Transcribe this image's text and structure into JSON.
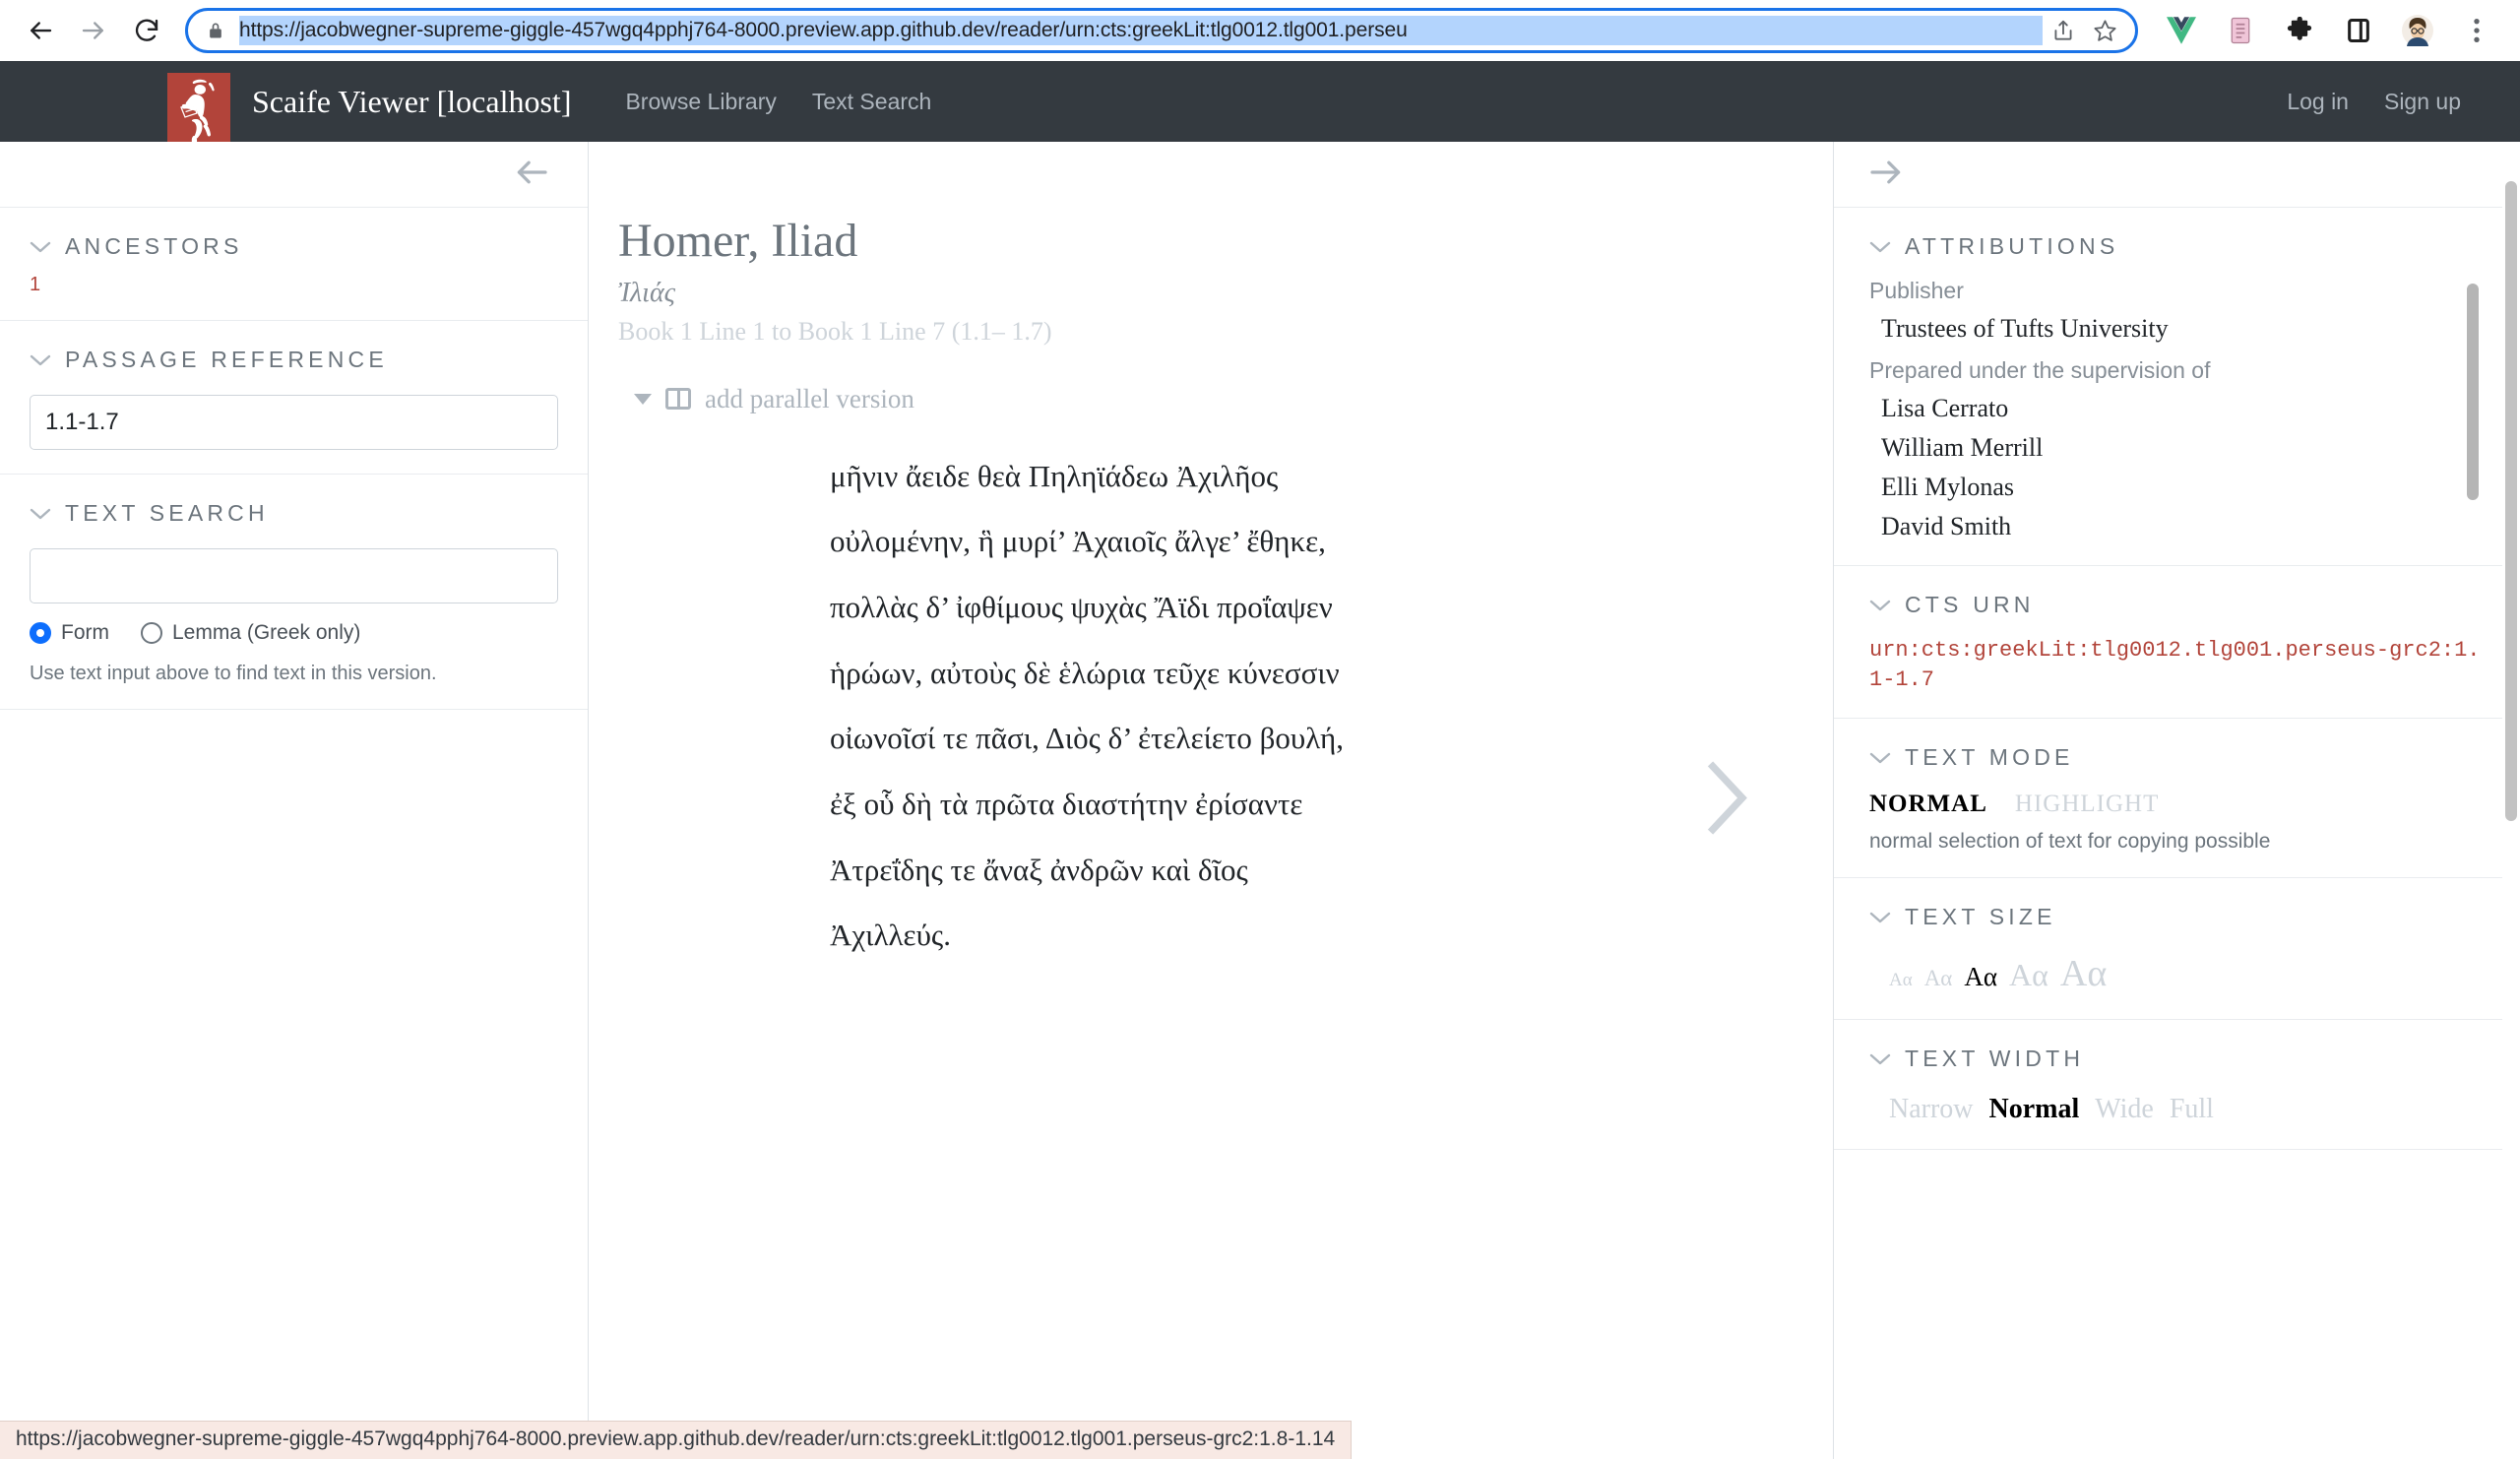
{
  "browser": {
    "back_icon": "arrow-left-icon",
    "forward_icon": "arrow-right-icon",
    "reload_icon": "reload-icon",
    "lock_icon": "lock-icon",
    "url": "https://jacobwegner-supreme-giggle-457wgq4pphj764-8000.preview.app.github.dev/reader/urn:cts:greekLit:tlg0012.tlg001.perseu",
    "share_icon": "share-icon",
    "bookmark_icon": "star-icon",
    "extensions": [
      "vue-devtools-icon",
      "reading-list-icon",
      "puzzle-piece-icon",
      "sidebar-panel-icon",
      "profile-avatar-icon",
      "kebab-menu-icon"
    ],
    "accent": "#1a73e8",
    "selection_color": "#b3d4fd"
  },
  "header": {
    "brand": "Scaife Viewer [localhost]",
    "logo_alt": "scaife-runner-logo",
    "logo_bg": "#b2443a",
    "bar_bg": "#343a40",
    "nav": [
      {
        "label": "Browse Library",
        "name": "nav-browse-library"
      },
      {
        "label": "Text Search",
        "name": "nav-text-search"
      }
    ],
    "nav_right": [
      {
        "label": "Log in",
        "name": "nav-login"
      },
      {
        "label": "Sign up",
        "name": "nav-signup"
      }
    ]
  },
  "left_sidebar": {
    "collapse_icon": "arrow-left-icon",
    "ancestors": {
      "title": "Ancestors",
      "items": [
        "1"
      ]
    },
    "passage_reference": {
      "title": "Passage Reference",
      "value": "1.1-1.7"
    },
    "text_search": {
      "title": "Text Search",
      "value": "",
      "placeholder": "",
      "options": [
        {
          "label": "Form",
          "checked": true
        },
        {
          "label": "Lemma (Greek only)",
          "checked": false
        }
      ],
      "hint": "Use text input above to find text in this version."
    }
  },
  "center": {
    "title": "Homer, Iliad",
    "subtitle": "Ἰλιάς",
    "reference": "Book 1 Line 1 to Book 1 Line 7 (1.1– 1.7)",
    "add_parallel_label": "add parallel version",
    "next_icon": "chevron-right-icon",
    "lines": [
      "μῆνιν ἄειδε θεὰ Πηληϊάδεω Ἀχιλῆος",
      "οὐλομένην, ἣ μυρί’ Ἀχαιοῖς ἄλγε’ ἔθηκε,",
      "πολλὰς δ’ ἰφθίμους ψυχὰς Ἄϊδι προΐαψεν",
      "ἡρώων, αὐτοὺς δὲ ἑλώρια τεῦχε κύνεσσιν",
      "οἰωνοῖσί τε πᾶσι, Διὸς δ’ ἐτελείετο βουλή,",
      "ἐξ οὗ δὴ τὰ πρῶτα διαστήτην ἐρίσαντε",
      "Ἀτρεΐδης τε ἄναξ ἀνδρῶν καὶ δῖος",
      "Ἀχιλλεύς."
    ]
  },
  "right_sidebar": {
    "collapse_icon": "arrow-right-icon",
    "attributions": {
      "title": "Attributions",
      "groups": [
        {
          "label": "Publisher",
          "values": [
            "Trustees of Tufts University"
          ]
        },
        {
          "label": "Prepared under the supervision of",
          "values": [
            "Lisa Cerrato",
            "William Merrill",
            "Elli Mylonas",
            "David Smith"
          ]
        }
      ]
    },
    "cts_urn": {
      "title": "CTS URN",
      "value": "urn:cts:greekLit:tlg0012.tlg001.perseus-grc2:1.1-1.7",
      "color": "#b2443a"
    },
    "text_mode": {
      "title": "Text Mode",
      "options": [
        {
          "label": "NORMAL",
          "active": true
        },
        {
          "label": "HIGHLIGHT",
          "active": false
        }
      ],
      "hint": "normal selection of text for copying possible"
    },
    "text_size": {
      "title": "Text Size",
      "options": [
        {
          "label": "Aα",
          "active": false
        },
        {
          "label": "Aα",
          "active": false
        },
        {
          "label": "Aα",
          "active": true
        },
        {
          "label": "Aα",
          "active": false
        },
        {
          "label": "Aα",
          "active": false
        }
      ]
    },
    "text_width": {
      "title": "Text Width",
      "options": [
        {
          "label": "Narrow",
          "active": false
        },
        {
          "label": "Normal",
          "active": true
        },
        {
          "label": "Wide",
          "active": false
        },
        {
          "label": "Full",
          "active": false
        }
      ]
    }
  },
  "status_bar": {
    "url": "https://jacobwegner-supreme-giggle-457wgq4pphj764-8000.preview.app.github.dev/reader/urn:cts:greekLit:tlg0012.tlg001.perseus-grc2:1.8-1.14"
  }
}
